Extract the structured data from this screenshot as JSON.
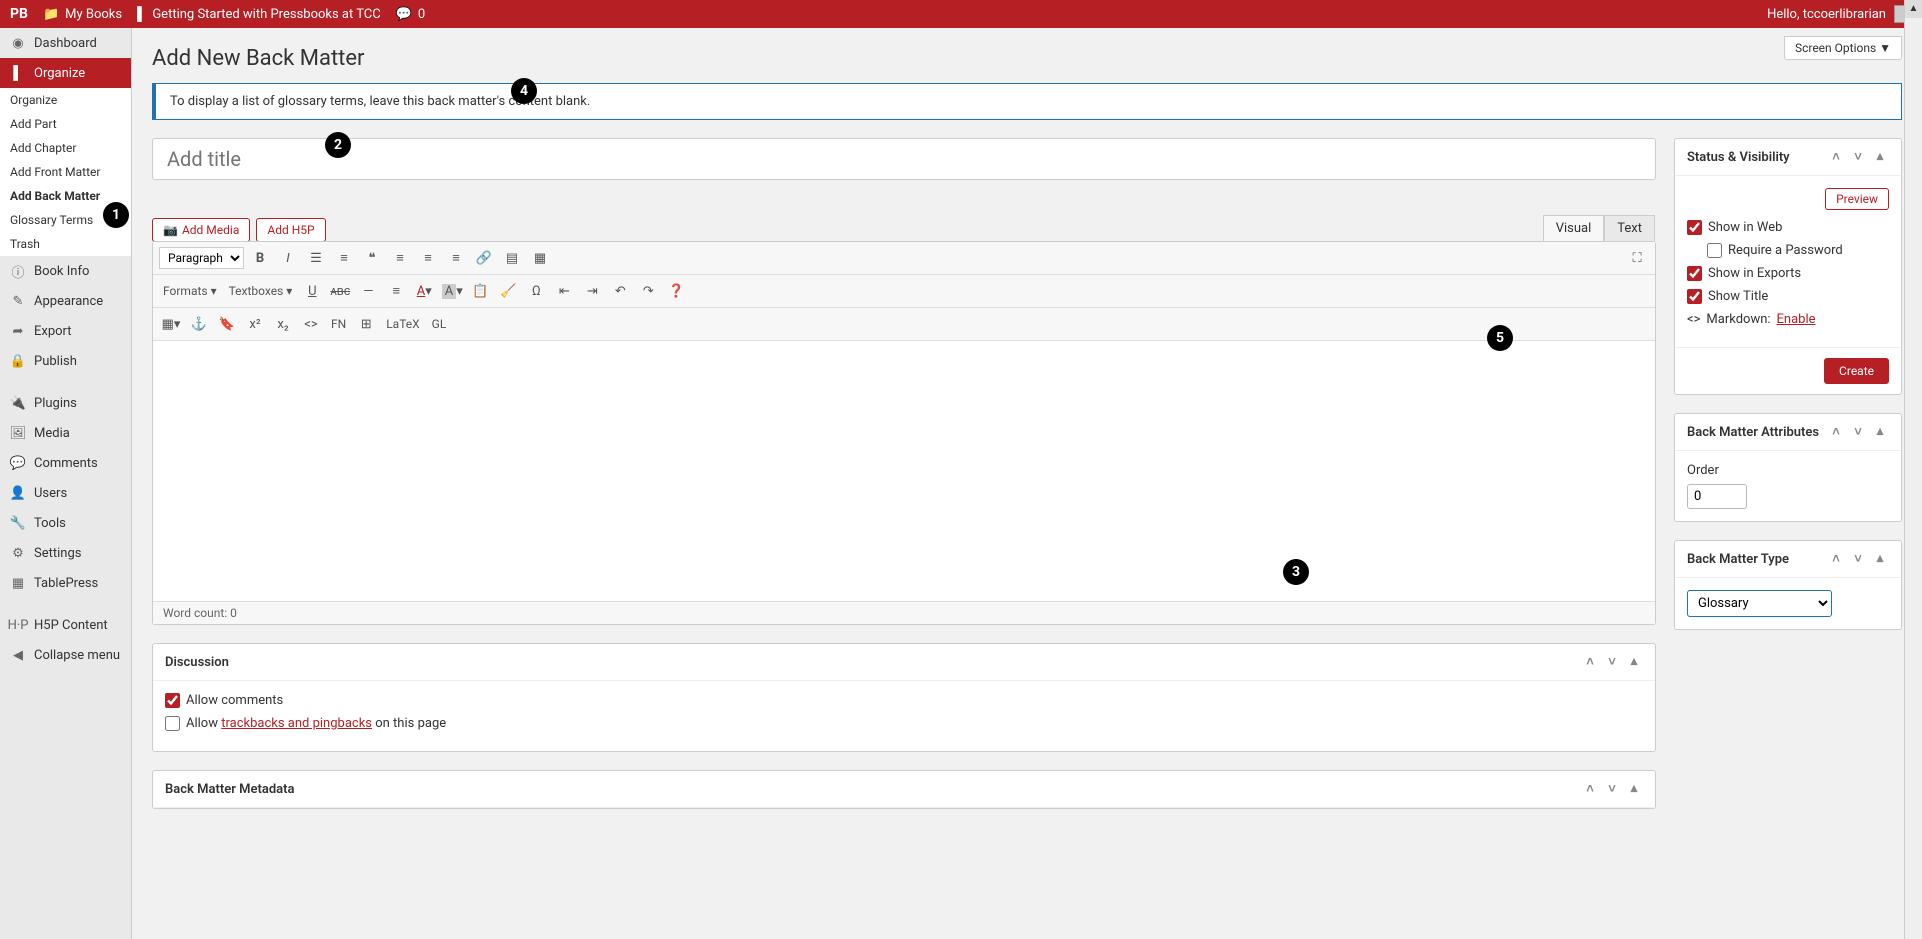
{
  "topbar": {
    "logo": "PB",
    "my_books": "My Books",
    "current_book": "Getting Started with Pressbooks at TCC",
    "comments_count": "0",
    "hello": "Hello, tccoerlibrarian"
  },
  "sidebar": {
    "dashboard": "Dashboard",
    "organize": "Organize",
    "sub": {
      "organize": "Organize",
      "add_part": "Add Part",
      "add_chapter": "Add Chapter",
      "add_front": "Add Front Matter",
      "add_back": "Add Back Matter",
      "glossary": "Glossary Terms",
      "trash": "Trash"
    },
    "book_info": "Book Info",
    "appearance": "Appearance",
    "export": "Export",
    "publish": "Publish",
    "plugins": "Plugins",
    "media": "Media",
    "comments": "Comments",
    "users": "Users",
    "tools": "Tools",
    "settings": "Settings",
    "tablepress": "TablePress",
    "h5p": "H5P Content",
    "collapse": "Collapse menu"
  },
  "page_title": "Add New Back Matter",
  "screen_options": "Screen Options ▼",
  "notice": "To display a list of glossary terms, leave this back matter's content blank.",
  "title_placeholder": "Add title",
  "editor": {
    "add_media": "Add Media",
    "add_h5p": "Add H5P",
    "tab_visual": "Visual",
    "tab_text": "Text",
    "paragraph": "Paragraph",
    "formats": "Formats ▾",
    "textboxes": "Textboxes ▾",
    "fn": "FN",
    "latex": "LaTeX",
    "gl": "GL",
    "wordcount": "Word count: 0"
  },
  "status_panel": {
    "title": "Status & Visibility",
    "preview": "Preview",
    "show_web": "Show in Web",
    "require_pw": "Require a Password",
    "show_exports": "Show in Exports",
    "show_title": "Show Title",
    "markdown_label": "Markdown:",
    "markdown_link": "Enable",
    "create": "Create"
  },
  "attrs_panel": {
    "title": "Back Matter Attributes",
    "order_label": "Order",
    "order_value": "0"
  },
  "type_panel": {
    "title": "Back Matter Type",
    "selected": "Glossary"
  },
  "discussion": {
    "title": "Discussion",
    "allow_comments": "Allow comments",
    "allow_prefix": "Allow ",
    "trackbacks_link": "trackbacks and pingbacks",
    "allow_suffix": " on this page"
  },
  "metadata": {
    "title": "Back Matter Metadata"
  },
  "circles": {
    "c1": "1",
    "c2": "2",
    "c3": "3",
    "c4": "4",
    "c5": "5"
  }
}
